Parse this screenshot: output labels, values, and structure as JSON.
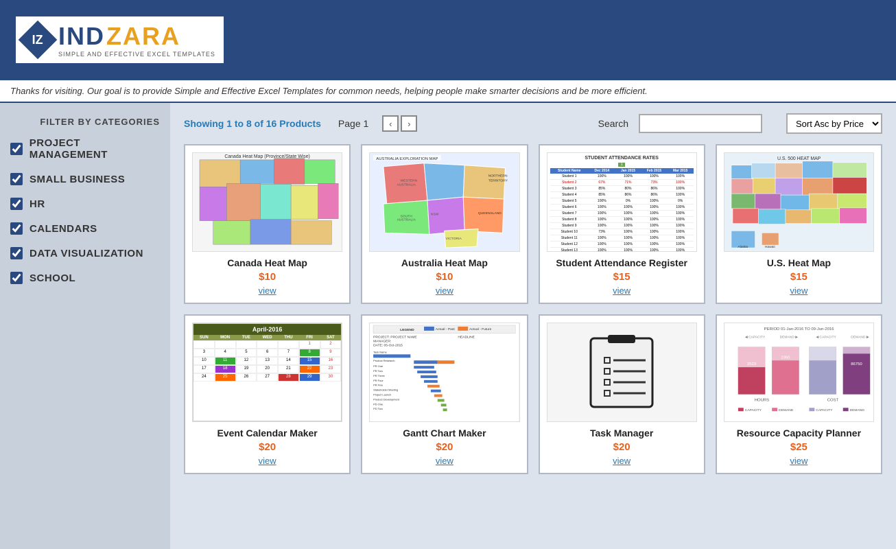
{
  "header": {
    "logo_ind": "IND",
    "logo_zara": "ZARA",
    "tagline": "SIMPLE AND EFFECTIVE EXCEL TEMPLATES"
  },
  "banner": {
    "text": "Thanks for visiting. Our goal is to provide Simple and Effective Excel Templates for common needs, helping people make smarter decisions and be more efficient."
  },
  "sidebar": {
    "filter_title": "FILTER BY CATEGORIES",
    "categories": [
      {
        "id": "project-management",
        "label": "PROJECT MANAGEMENT",
        "checked": true
      },
      {
        "id": "small-business",
        "label": "SMALL BUSINESS",
        "checked": true
      },
      {
        "id": "hr",
        "label": "HR",
        "checked": true
      },
      {
        "id": "calendars",
        "label": "CALENDARS",
        "checked": true
      },
      {
        "id": "data-visualization",
        "label": "DATA VISUALIZATION",
        "checked": true
      },
      {
        "id": "school",
        "label": "SCHOOL",
        "checked": true
      }
    ]
  },
  "toolbar": {
    "showing": "Showing 1 to 8 of 16 Products",
    "page_label": "Page 1",
    "search_label": "Search",
    "search_placeholder": "",
    "sort_value": "Sort Asc by Price"
  },
  "products": [
    {
      "id": "canada-heat-map",
      "name": "Canada Heat Map",
      "price": "$10",
      "view": "view",
      "type": "canada-map"
    },
    {
      "id": "australia-heat-map",
      "name": "Australia Heat Map",
      "price": "$10",
      "view": "view",
      "type": "australia-map"
    },
    {
      "id": "student-attendance",
      "name": "Student Attendance Register",
      "price": "$15",
      "view": "view",
      "type": "attendance"
    },
    {
      "id": "us-heat-map",
      "name": "U.S. Heat Map",
      "price": "$15",
      "view": "view",
      "type": "us-map"
    },
    {
      "id": "event-calendar",
      "name": "Event Calendar Maker",
      "price": "$20",
      "view": "view",
      "type": "calendar"
    },
    {
      "id": "gantt-chart",
      "name": "Gantt Chart Maker",
      "price": "$20",
      "view": "view",
      "type": "gantt"
    },
    {
      "id": "task-manager",
      "name": "Task Manager",
      "price": "$20",
      "view": "view",
      "type": "task"
    },
    {
      "id": "resource-capacity",
      "name": "Resource Capacity Planner",
      "price": "$25",
      "view": "view",
      "type": "resource"
    }
  ]
}
